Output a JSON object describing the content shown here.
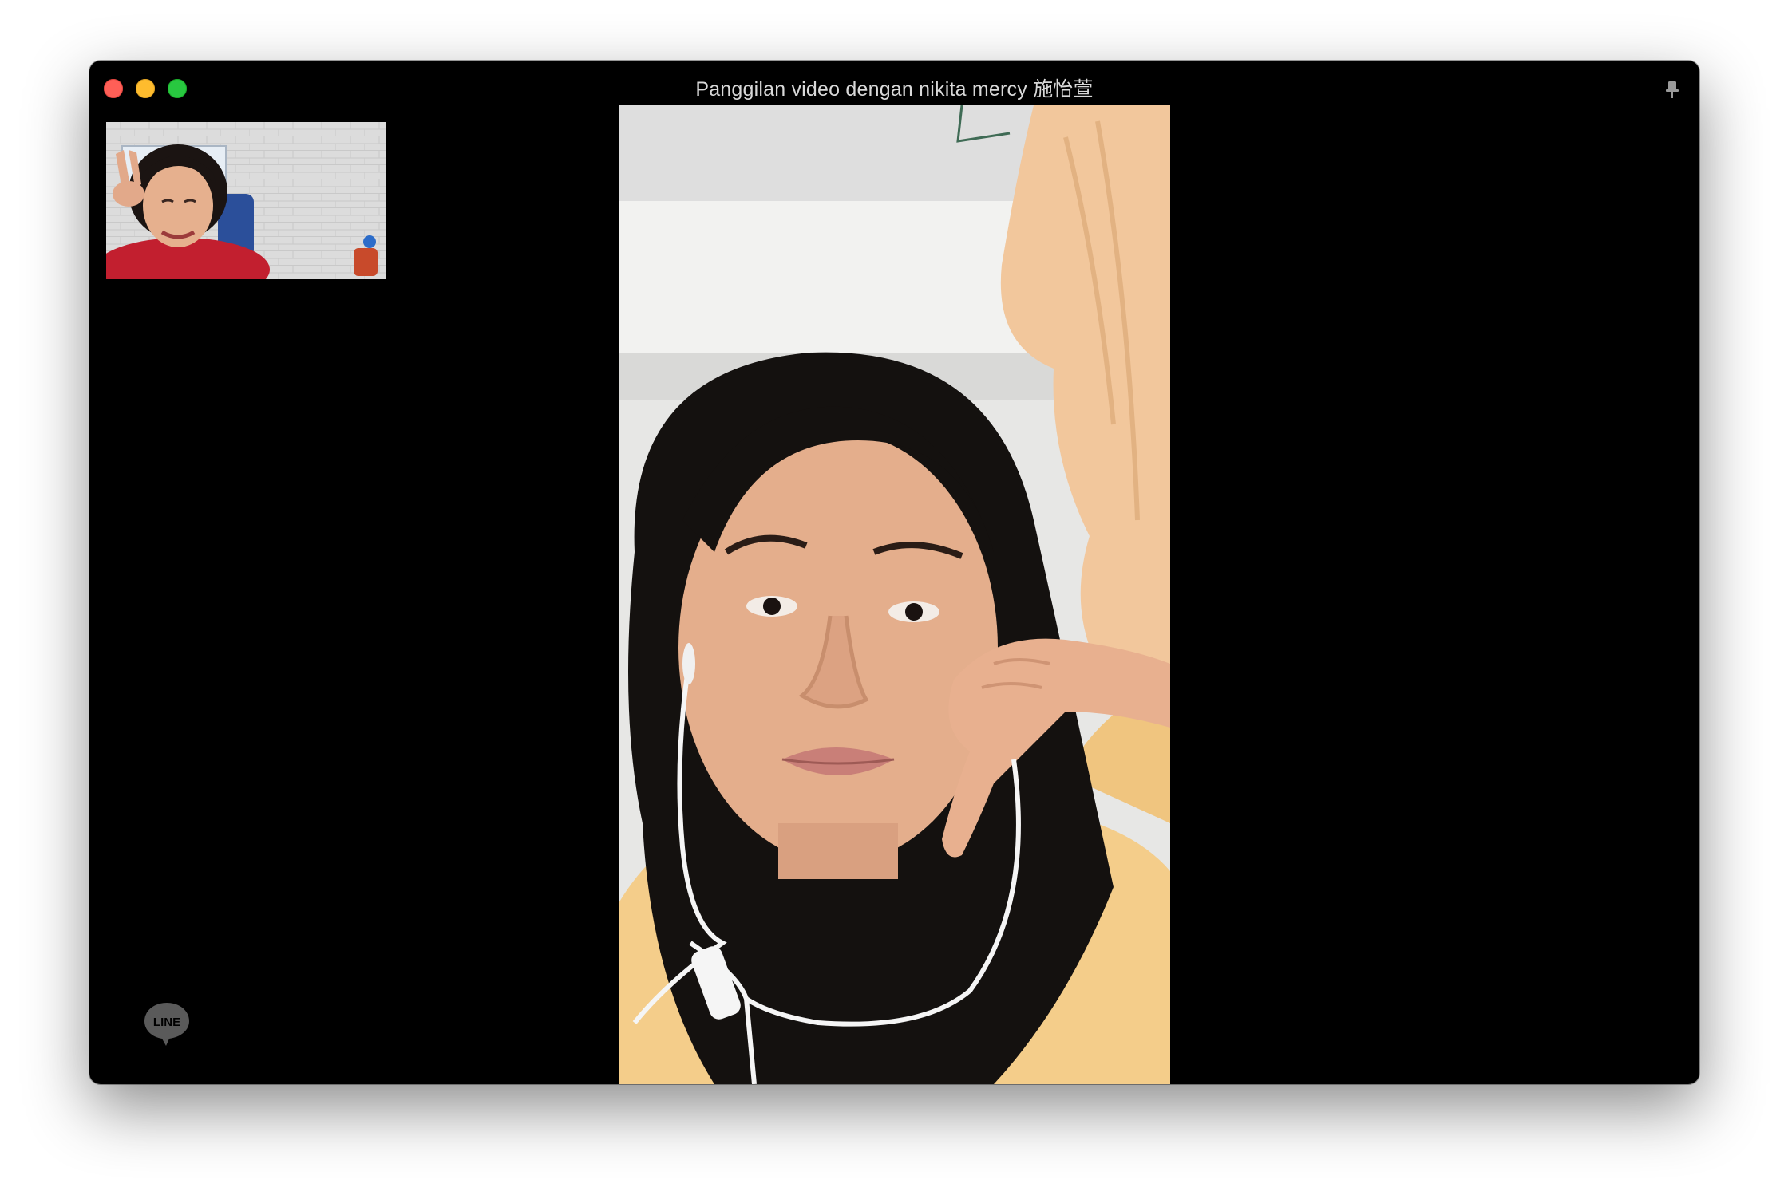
{
  "window": {
    "title": "Panggilan video dengan nikita mercy 施怡萱"
  },
  "controls": {
    "close_icon": "close-icon",
    "minimize_icon": "minimize-icon",
    "maximize_icon": "maximize-icon",
    "pin_icon": "pin-icon"
  },
  "self_view": {
    "icon": "self-camera-preview"
  },
  "remote_view": {
    "icon": "remote-video-feed"
  },
  "branding": {
    "logo_text": "LINE",
    "icon": "line-logo-icon"
  },
  "colors": {
    "window_bg": "#000000",
    "close": "#ff5f57",
    "minimize": "#febc2e",
    "maximize": "#28c840",
    "title_text": "#d8d8d8"
  }
}
